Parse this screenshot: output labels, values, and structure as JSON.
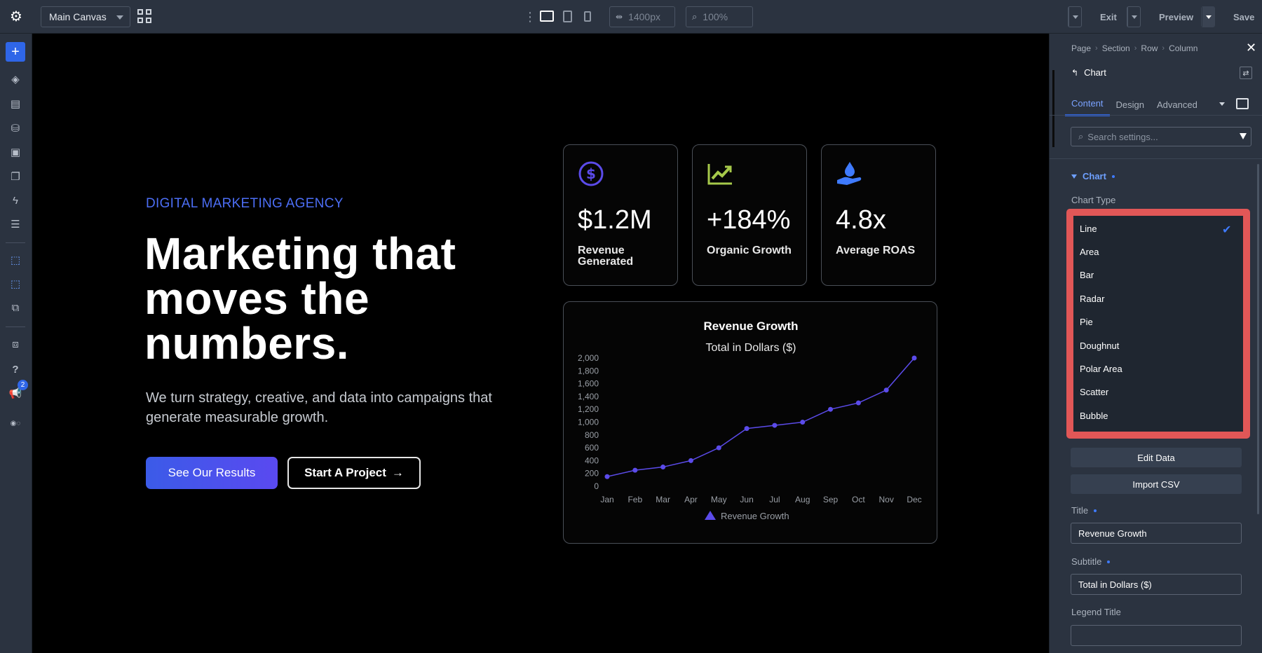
{
  "toolbar": {
    "canvas_select": "Main Canvas",
    "width_field": "1400px",
    "zoom_field": "100%",
    "exit_label": "Exit",
    "preview_label": "Preview",
    "save_label": "Save"
  },
  "left_sidebar": {
    "add_label": "+",
    "help_label": "?",
    "notifications_count": "2"
  },
  "hero": {
    "eyebrow": "DIGITAL MARKETING AGENCY",
    "headline_line1": "Marketing that",
    "headline_line2": "moves the",
    "headline_line3": "numbers.",
    "lede": "We turn strategy, creative, and data into campaigns that generate measurable growth.",
    "primary_button": "See Our Results",
    "secondary_button": "Start A Project",
    "secondary_arrow": "→"
  },
  "stats": [
    {
      "value": "$1.2M",
      "caption": "Revenue Generated",
      "icon": "dollar-circle-icon",
      "color": "#5b4bea"
    },
    {
      "value": "+184%",
      "caption": "Organic Growth",
      "icon": "trend-chart-icon",
      "color": "#a6c94a"
    },
    {
      "value": "4.8x",
      "caption": "Average ROAS",
      "icon": "hand-drop-icon",
      "color": "#3f7bff"
    }
  ],
  "chart_data": {
    "type": "line",
    "title": "Revenue Growth",
    "subtitle": "Total in Dollars ($)",
    "categories": [
      "Jan",
      "Feb",
      "Mar",
      "Apr",
      "May",
      "Jun",
      "Jul",
      "Aug",
      "Sep",
      "Oct",
      "Nov",
      "Dec"
    ],
    "series": [
      {
        "name": "Revenue Growth",
        "values": [
          150,
          250,
          300,
          400,
          600,
          900,
          950,
          1000,
          1200,
          1300,
          1500,
          2000
        ],
        "color": "#5b4bea"
      }
    ],
    "yticks": [
      "2,000",
      "1,800",
      "1,600",
      "1,400",
      "1,200",
      "1,000",
      "800",
      "600",
      "400",
      "200",
      "0"
    ],
    "ylim": [
      0,
      2000
    ],
    "legend_position": "bottom",
    "grid": false
  },
  "panel": {
    "breadcrumbs": [
      "Page",
      "Section",
      "Row",
      "Column"
    ],
    "module_title": "Chart",
    "tabs": [
      "Content",
      "Design",
      "Advanced"
    ],
    "search_placeholder": "Search settings...",
    "section_title": "Chart",
    "chart_type_label": "Chart Type",
    "chart_type_options": [
      "Line",
      "Area",
      "Bar",
      "Radar",
      "Pie",
      "Doughnut",
      "Polar Area",
      "Scatter",
      "Bubble"
    ],
    "selected_option": "Line",
    "edit_data_label": "Edit Data",
    "import_csv_label": "Import CSV",
    "title_label": "Title",
    "title_value": "Revenue Growth",
    "subtitle_label": "Subtitle",
    "subtitle_value": "Total in Dollars ($)",
    "legend_title_label": "Legend Title",
    "legend_title_value": ""
  },
  "colors": {
    "accent": "#2f66e8",
    "highlight": "#e15757",
    "chart_line": "#5b4bea"
  }
}
